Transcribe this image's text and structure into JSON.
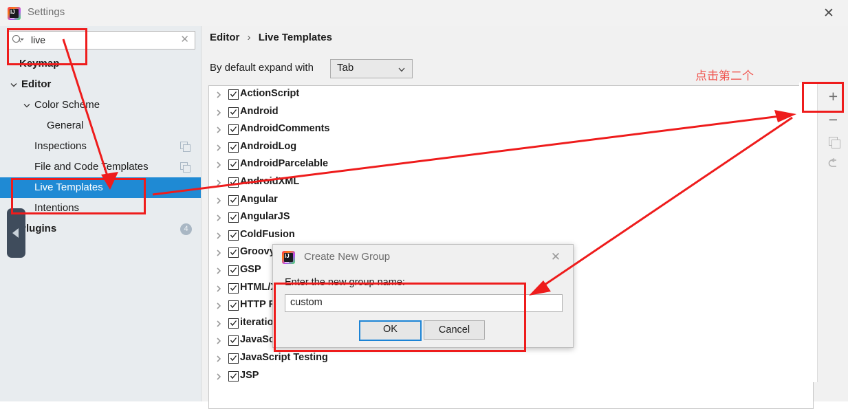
{
  "window": {
    "title": "Settings",
    "close_label": "✕",
    "app_icon": "intellij-idea-logo"
  },
  "sidebar": {
    "search": {
      "value": "live",
      "clear_label": "✕",
      "icon": "search-icon"
    },
    "items": [
      {
        "label": "Keymap",
        "depth": 0,
        "bold": true,
        "chevron": "none",
        "selected": false,
        "copy": false,
        "badge": null
      },
      {
        "label": "Editor",
        "depth": 0,
        "bold": true,
        "chevron": "down",
        "selected": false,
        "copy": false,
        "badge": null
      },
      {
        "label": "Color Scheme",
        "depth": 1,
        "bold": false,
        "chevron": "down",
        "selected": false,
        "copy": false,
        "badge": null
      },
      {
        "label": "General",
        "depth": 2,
        "bold": false,
        "chevron": "none",
        "selected": false,
        "copy": false,
        "badge": null
      },
      {
        "label": "Inspections",
        "depth": 1,
        "bold": false,
        "chevron": "none",
        "selected": false,
        "copy": true,
        "badge": null
      },
      {
        "label": "File and Code Templates",
        "depth": 1,
        "bold": false,
        "chevron": "none",
        "selected": false,
        "copy": true,
        "badge": null
      },
      {
        "label": "Live Templates",
        "depth": 1,
        "bold": false,
        "chevron": "none",
        "selected": true,
        "copy": false,
        "badge": null
      },
      {
        "label": "Intentions",
        "depth": 1,
        "bold": false,
        "chevron": "none",
        "selected": false,
        "copy": false,
        "badge": null
      },
      {
        "label": "Plugins",
        "depth": 0,
        "bold": true,
        "chevron": "none",
        "selected": false,
        "copy": false,
        "badge": "4"
      }
    ],
    "collapse_handle": "collapse-sidebar-handle"
  },
  "main": {
    "breadcrumb": {
      "root": "Editor",
      "separator": "›",
      "leaf": "Live Templates"
    },
    "expand_with": {
      "label": "By default expand with",
      "value": "Tab"
    },
    "templates": [
      {
        "name": "ActionScript",
        "checked": true
      },
      {
        "name": "Android",
        "checked": true
      },
      {
        "name": "AndroidComments",
        "checked": true
      },
      {
        "name": "AndroidLog",
        "checked": true
      },
      {
        "name": "AndroidParcelable",
        "checked": true
      },
      {
        "name": "AndroidXML",
        "checked": true
      },
      {
        "name": "Angular",
        "checked": true
      },
      {
        "name": "AngularJS",
        "checked": true
      },
      {
        "name": "ColdFusion",
        "checked": true
      },
      {
        "name": "Groovy",
        "checked": true
      },
      {
        "name": "GSP",
        "checked": true
      },
      {
        "name": "HTML/XML",
        "checked": true
      },
      {
        "name": "HTTP Request",
        "checked": true
      },
      {
        "name": "iterations",
        "checked": true
      },
      {
        "name": "JavaScript",
        "checked": true
      },
      {
        "name": "JavaScript Testing",
        "checked": true
      },
      {
        "name": "JSP",
        "checked": true
      }
    ]
  },
  "toolbar": {
    "add_label": "+",
    "remove_label": "−",
    "duplicate_label": "duplicate-icon",
    "revert_label": "revert-icon"
  },
  "dialog": {
    "title": "Create New Group",
    "close_label": "✕",
    "prompt": "Enter the new group name:",
    "input_value": "custom",
    "ok_label": "OK",
    "cancel_label": "Cancel"
  },
  "annotations": {
    "note_text": "点击第二个",
    "color": "#ee1c1c",
    "note_color": "#f0554f"
  }
}
